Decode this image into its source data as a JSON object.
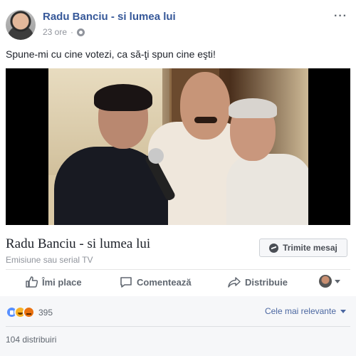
{
  "post": {
    "page_name": "Radu Banciu - si lumea lui",
    "timestamp": "23 ore",
    "separator": "·",
    "text": "Spune-mi cu cine votezi, ca să-ţi spun cine eşti!",
    "more": "···"
  },
  "link_preview": {
    "title": "Radu Banciu - si lumea lui",
    "subtitle": "Emisiune sau serial TV",
    "message_button": "Trimite mesaj"
  },
  "actions": {
    "like": "Îmi place",
    "comment": "Comentează",
    "share": "Distribuie"
  },
  "reactions": {
    "count": "395",
    "types": [
      "like-icon",
      "haha-icon",
      "angry-icon"
    ],
    "sort_label": "Cele mai relevante"
  },
  "shares": {
    "label": "104 distribuiri"
  },
  "colors": {
    "link_blue": "#365899",
    "muted": "#90949c",
    "action_gray": "#606770",
    "like_blue": "#5890ff"
  }
}
